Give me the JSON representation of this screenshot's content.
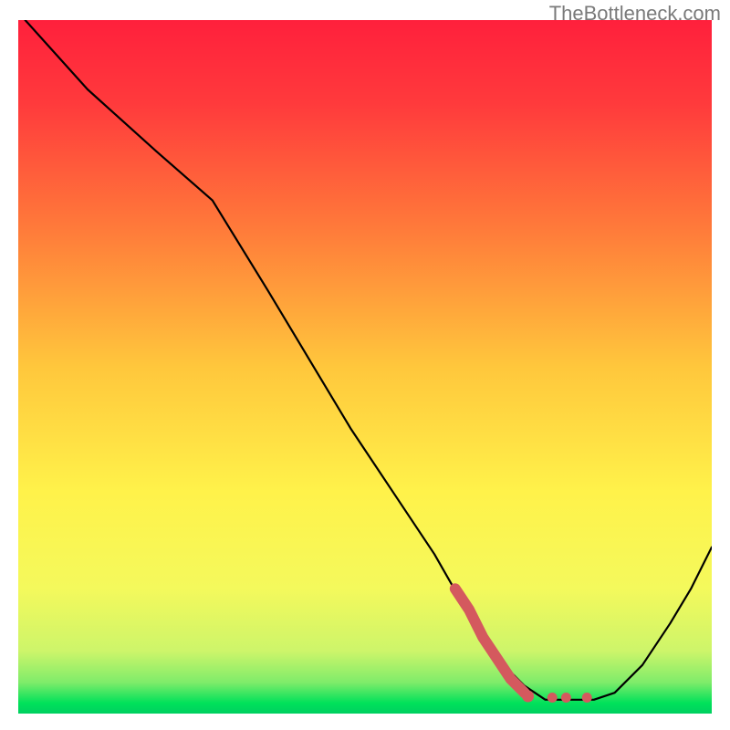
{
  "watermark": "TheBottleneck.com",
  "colors": {
    "curve": "#000000",
    "accent": "#d4595e",
    "green": "#00e15a",
    "lime": "#c6f562",
    "yellow": "#fff24a",
    "orange": "#ff9a3a",
    "red": "#ff203c"
  },
  "chart_data": {
    "type": "line",
    "title": "",
    "xlabel": "",
    "ylabel": "",
    "xlim": [
      0,
      100
    ],
    "ylim": [
      0,
      100
    ],
    "curve": {
      "name": "bottleneck-curve",
      "x": [
        1,
        10,
        20,
        28,
        36,
        42,
        48,
        54,
        60,
        64,
        68,
        71,
        73,
        76,
        80,
        83,
        86,
        90,
        94,
        97,
        100
      ],
      "y": [
        100,
        90,
        81,
        74,
        61,
        51,
        41,
        32,
        23,
        16,
        10,
        6,
        4,
        2,
        2,
        2,
        3,
        7,
        13,
        18,
        24
      ]
    },
    "accent_segment": {
      "name": "optimal-region",
      "x": [
        63,
        65,
        67,
        69,
        71,
        73
      ],
      "y": [
        18,
        15,
        11,
        8,
        5,
        3
      ]
    },
    "accent_dots": {
      "name": "optimal-points",
      "x": [
        73.5,
        77,
        79,
        82
      ],
      "y": [
        2.5,
        2.3,
        2.3,
        2.3
      ]
    }
  }
}
